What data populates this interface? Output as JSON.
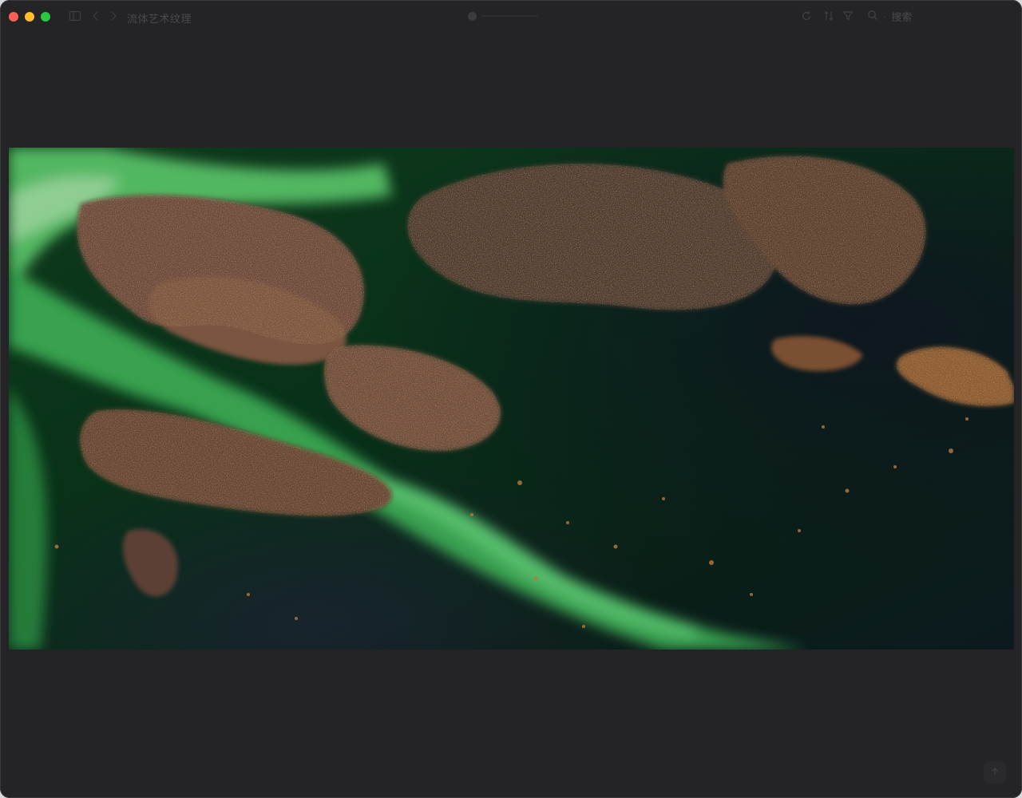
{
  "window": {
    "title": "流体艺术纹理"
  },
  "toolbar": {
    "search_label": "搜索"
  },
  "colors": {
    "background": "#242426",
    "close": "#ff5f57",
    "minimize": "#febc2e",
    "maximize": "#28c840"
  },
  "icons": {
    "sidebar": "sidebar-toggle-icon",
    "back": "chevron-left-icon",
    "forward": "chevron-right-icon",
    "refresh": "refresh-icon",
    "sort": "sort-icon",
    "filter": "filter-icon",
    "search": "search-icon",
    "scroll_top": "arrow-up-icon"
  },
  "image": {
    "alt": "流体艺术纹理"
  }
}
